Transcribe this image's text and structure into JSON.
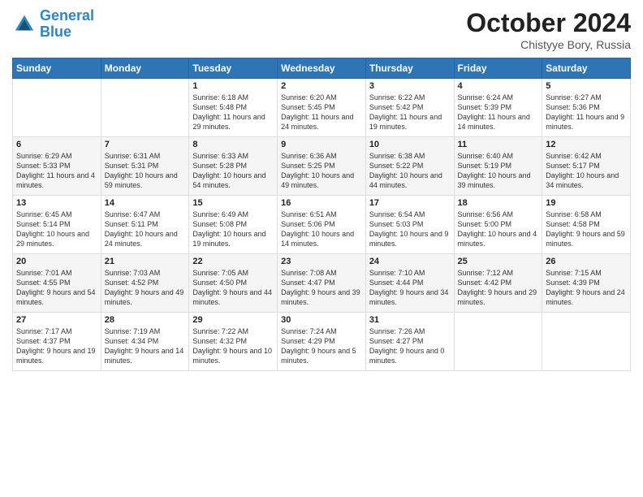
{
  "header": {
    "logo_line1": "General",
    "logo_line2": "Blue",
    "title": "October 2024",
    "subtitle": "Chistyye Bory, Russia"
  },
  "days_of_week": [
    "Sunday",
    "Monday",
    "Tuesday",
    "Wednesday",
    "Thursday",
    "Friday",
    "Saturday"
  ],
  "weeks": [
    [
      {
        "day": "",
        "text": ""
      },
      {
        "day": "",
        "text": ""
      },
      {
        "day": "1",
        "text": "Sunrise: 6:18 AM\nSunset: 5:48 PM\nDaylight: 11 hours and 29 minutes."
      },
      {
        "day": "2",
        "text": "Sunrise: 6:20 AM\nSunset: 5:45 PM\nDaylight: 11 hours and 24 minutes."
      },
      {
        "day": "3",
        "text": "Sunrise: 6:22 AM\nSunset: 5:42 PM\nDaylight: 11 hours and 19 minutes."
      },
      {
        "day": "4",
        "text": "Sunrise: 6:24 AM\nSunset: 5:39 PM\nDaylight: 11 hours and 14 minutes."
      },
      {
        "day": "5",
        "text": "Sunrise: 6:27 AM\nSunset: 5:36 PM\nDaylight: 11 hours and 9 minutes."
      }
    ],
    [
      {
        "day": "6",
        "text": "Sunrise: 6:29 AM\nSunset: 5:33 PM\nDaylight: 11 hours and 4 minutes."
      },
      {
        "day": "7",
        "text": "Sunrise: 6:31 AM\nSunset: 5:31 PM\nDaylight: 10 hours and 59 minutes."
      },
      {
        "day": "8",
        "text": "Sunrise: 6:33 AM\nSunset: 5:28 PM\nDaylight: 10 hours and 54 minutes."
      },
      {
        "day": "9",
        "text": "Sunrise: 6:36 AM\nSunset: 5:25 PM\nDaylight: 10 hours and 49 minutes."
      },
      {
        "day": "10",
        "text": "Sunrise: 6:38 AM\nSunset: 5:22 PM\nDaylight: 10 hours and 44 minutes."
      },
      {
        "day": "11",
        "text": "Sunrise: 6:40 AM\nSunset: 5:19 PM\nDaylight: 10 hours and 39 minutes."
      },
      {
        "day": "12",
        "text": "Sunrise: 6:42 AM\nSunset: 5:17 PM\nDaylight: 10 hours and 34 minutes."
      }
    ],
    [
      {
        "day": "13",
        "text": "Sunrise: 6:45 AM\nSunset: 5:14 PM\nDaylight: 10 hours and 29 minutes."
      },
      {
        "day": "14",
        "text": "Sunrise: 6:47 AM\nSunset: 5:11 PM\nDaylight: 10 hours and 24 minutes."
      },
      {
        "day": "15",
        "text": "Sunrise: 6:49 AM\nSunset: 5:08 PM\nDaylight: 10 hours and 19 minutes."
      },
      {
        "day": "16",
        "text": "Sunrise: 6:51 AM\nSunset: 5:06 PM\nDaylight: 10 hours and 14 minutes."
      },
      {
        "day": "17",
        "text": "Sunrise: 6:54 AM\nSunset: 5:03 PM\nDaylight: 10 hours and 9 minutes."
      },
      {
        "day": "18",
        "text": "Sunrise: 6:56 AM\nSunset: 5:00 PM\nDaylight: 10 hours and 4 minutes."
      },
      {
        "day": "19",
        "text": "Sunrise: 6:58 AM\nSunset: 4:58 PM\nDaylight: 9 hours and 59 minutes."
      }
    ],
    [
      {
        "day": "20",
        "text": "Sunrise: 7:01 AM\nSunset: 4:55 PM\nDaylight: 9 hours and 54 minutes."
      },
      {
        "day": "21",
        "text": "Sunrise: 7:03 AM\nSunset: 4:52 PM\nDaylight: 9 hours and 49 minutes."
      },
      {
        "day": "22",
        "text": "Sunrise: 7:05 AM\nSunset: 4:50 PM\nDaylight: 9 hours and 44 minutes."
      },
      {
        "day": "23",
        "text": "Sunrise: 7:08 AM\nSunset: 4:47 PM\nDaylight: 9 hours and 39 minutes."
      },
      {
        "day": "24",
        "text": "Sunrise: 7:10 AM\nSunset: 4:44 PM\nDaylight: 9 hours and 34 minutes."
      },
      {
        "day": "25",
        "text": "Sunrise: 7:12 AM\nSunset: 4:42 PM\nDaylight: 9 hours and 29 minutes."
      },
      {
        "day": "26",
        "text": "Sunrise: 7:15 AM\nSunset: 4:39 PM\nDaylight: 9 hours and 24 minutes."
      }
    ],
    [
      {
        "day": "27",
        "text": "Sunrise: 7:17 AM\nSunset: 4:37 PM\nDaylight: 9 hours and 19 minutes."
      },
      {
        "day": "28",
        "text": "Sunrise: 7:19 AM\nSunset: 4:34 PM\nDaylight: 9 hours and 14 minutes."
      },
      {
        "day": "29",
        "text": "Sunrise: 7:22 AM\nSunset: 4:32 PM\nDaylight: 9 hours and 10 minutes."
      },
      {
        "day": "30",
        "text": "Sunrise: 7:24 AM\nSunset: 4:29 PM\nDaylight: 9 hours and 5 minutes."
      },
      {
        "day": "31",
        "text": "Sunrise: 7:26 AM\nSunset: 4:27 PM\nDaylight: 9 hours and 0 minutes."
      },
      {
        "day": "",
        "text": ""
      },
      {
        "day": "",
        "text": ""
      }
    ]
  ]
}
